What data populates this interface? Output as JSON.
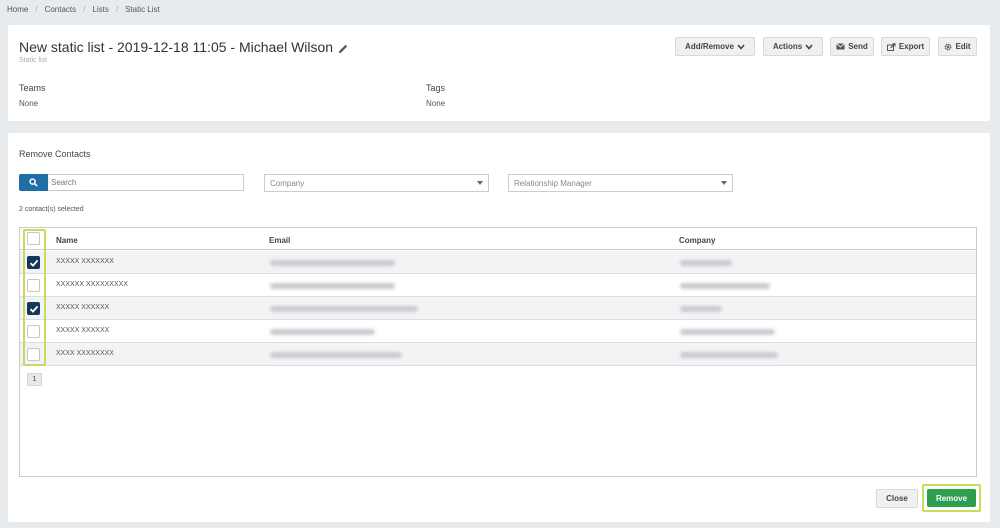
{
  "breadcrumb": [
    "Home",
    "Contacts",
    "Lists",
    "Static List"
  ],
  "header": {
    "title": "New static list - 2019-12-18 11:05 - Michael Wilson",
    "subtitle": "Static list",
    "buttons": {
      "add_remove": "Add/Remove",
      "actions": "Actions",
      "send": "Send",
      "export": "Export",
      "edit": "Edit"
    },
    "teams_label": "Teams",
    "teams_value": "None",
    "tags_label": "Tags",
    "tags_value": "None"
  },
  "main": {
    "section_title": "Remove Contacts",
    "search_placeholder": "Search",
    "company_placeholder": "Company",
    "manager_placeholder": "Relationship Manager",
    "selected_text": "2 contact(s) selected",
    "columns": [
      "Name",
      "Email",
      "Company"
    ],
    "rows": [
      {
        "name": "XXXXX XXXXXXX",
        "checked": true
      },
      {
        "name": "XXXXXX XXXXXXXXX",
        "checked": false
      },
      {
        "name": "XXXXX XXXXXX",
        "checked": true
      },
      {
        "name": "XXXXX XXXXXX",
        "checked": false
      },
      {
        "name": "XXXX XXXXXXXX",
        "checked": false
      }
    ],
    "page_number": "1",
    "close_label": "Close",
    "remove_label": "Remove"
  },
  "colors": {
    "primary": "#1e6fa5",
    "checkbox": "#14375a",
    "remove": "#2e9e4f",
    "highlight": "#c9dc5a"
  }
}
